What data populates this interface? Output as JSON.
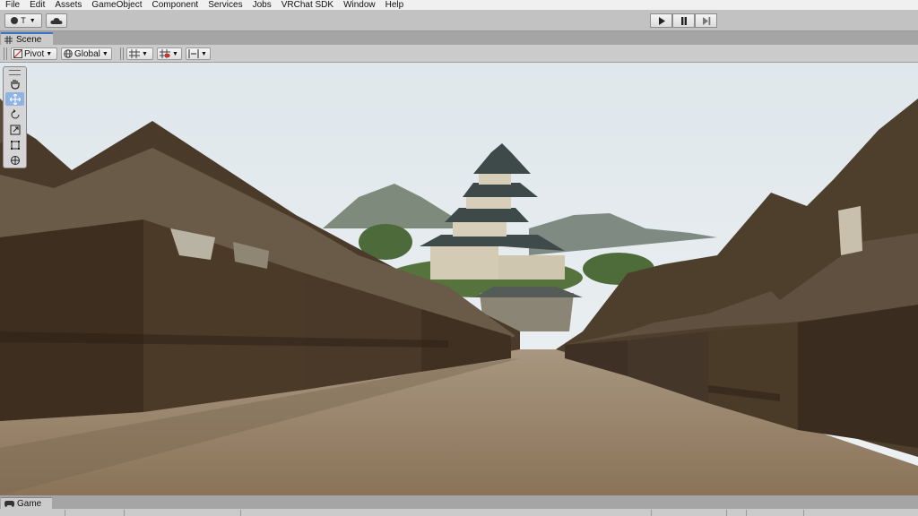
{
  "menu": [
    "File",
    "Edit",
    "Assets",
    "GameObject",
    "Component",
    "Services",
    "Jobs",
    "VRChat SDK",
    "Window",
    "Help"
  ],
  "toolbar": {
    "account_label": "T",
    "account_icon": "account-icon",
    "cloud_icon": "cloud-icon",
    "play_icon": "play-icon",
    "pause_icon": "pause-icon",
    "step_icon": "step-icon"
  },
  "scene_tab": {
    "label": "Scene",
    "icon": "grid-icon"
  },
  "scene_toolbar": {
    "pivot_label": "Pivot",
    "global_label": "Global"
  },
  "tools": [
    "hand-icon",
    "move-icon",
    "rotate-icon",
    "scale-icon",
    "rect-icon",
    "transform-icon"
  ],
  "game_tab": {
    "label": "Game",
    "icon": "gamepad-icon"
  },
  "colors": {
    "accent": "#3a72c4",
    "tool_active": "#8fb3e3"
  }
}
